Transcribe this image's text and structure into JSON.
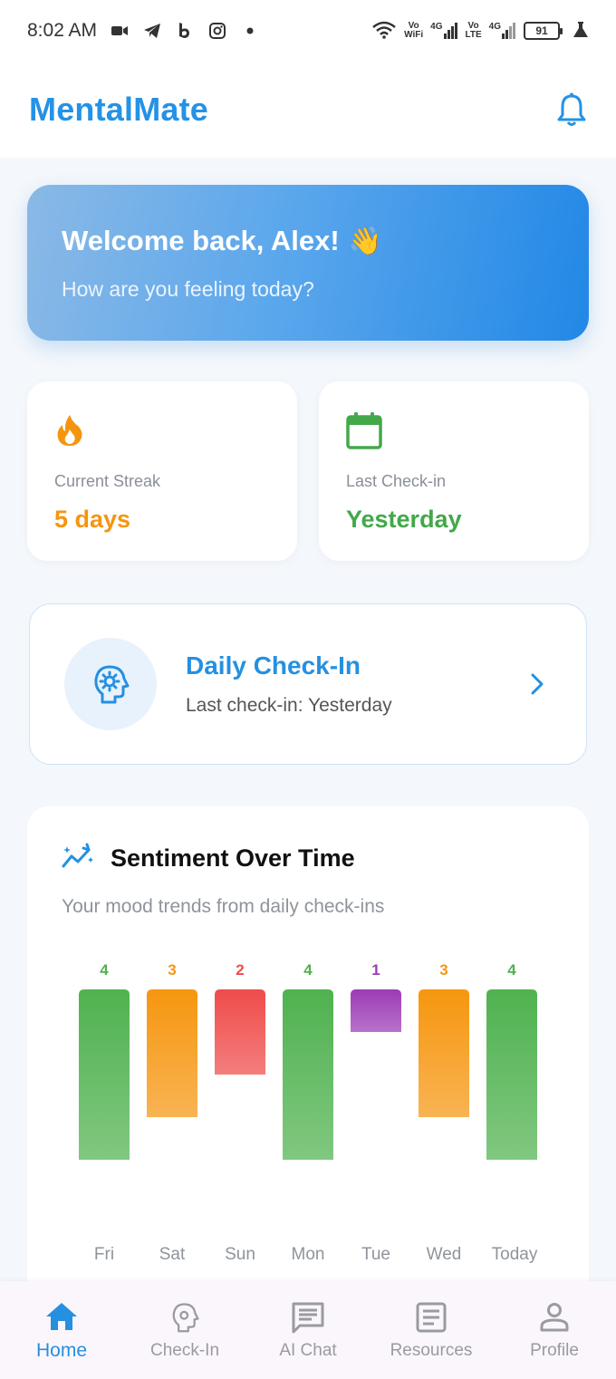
{
  "status_bar": {
    "time": "8:02 AM",
    "icons": [
      "video-icon",
      "telegram-icon",
      "b-icon",
      "instagram-icon",
      "dot-icon"
    ],
    "net1_top": "Vo",
    "net1_bottom": "WiFi",
    "sig1": "4G",
    "net2_top": "Vo",
    "net2_bottom": "LTE",
    "sig2": "4G",
    "battery": "91"
  },
  "app_bar": {
    "title": "MentalMate",
    "notification_icon": "bell-icon"
  },
  "welcome": {
    "title": "Welcome back, Alex!",
    "emoji": "👋",
    "subtitle": "How are you feeling today?"
  },
  "stats": {
    "streak": {
      "icon": "fire-icon",
      "label": "Current Streak",
      "value": "5 days",
      "color": "#f5950f"
    },
    "last_checkin": {
      "icon": "calendar-icon",
      "label": "Last Check-in",
      "value": "Yesterday",
      "color": "#43a849"
    }
  },
  "checkin_card": {
    "icon": "brain-gear-icon",
    "title": "Daily Check-In",
    "subtitle": "Last check-in: Yesterday",
    "chevron": "chevron-right-icon"
  },
  "sentiment": {
    "icon": "trend-sparkle-icon",
    "title": "Sentiment Over Time",
    "subtitle": "Your mood trends from daily check-ins"
  },
  "chart_data": {
    "type": "bar",
    "categories": [
      "Fri",
      "Sat",
      "Sun",
      "Mon",
      "Tue",
      "Wed",
      "Today"
    ],
    "values": [
      4,
      3,
      2,
      4,
      1,
      3,
      4
    ],
    "colors": {
      "1": "#9c3bb5",
      "2": "#ef4c4a",
      "3": "#f6960f",
      "4": "#4fb24f"
    },
    "ylim": [
      0,
      4
    ]
  },
  "bottom_nav": {
    "items": [
      {
        "label": "Home",
        "icon": "home-icon",
        "active": true
      },
      {
        "label": "Check-In",
        "icon": "brain-gear-icon",
        "active": false
      },
      {
        "label": "AI Chat",
        "icon": "chat-icon",
        "active": false
      },
      {
        "label": "Resources",
        "icon": "article-icon",
        "active": false
      },
      {
        "label": "Profile",
        "icon": "person-icon",
        "active": false
      }
    ],
    "active_color": "#2590e0"
  }
}
